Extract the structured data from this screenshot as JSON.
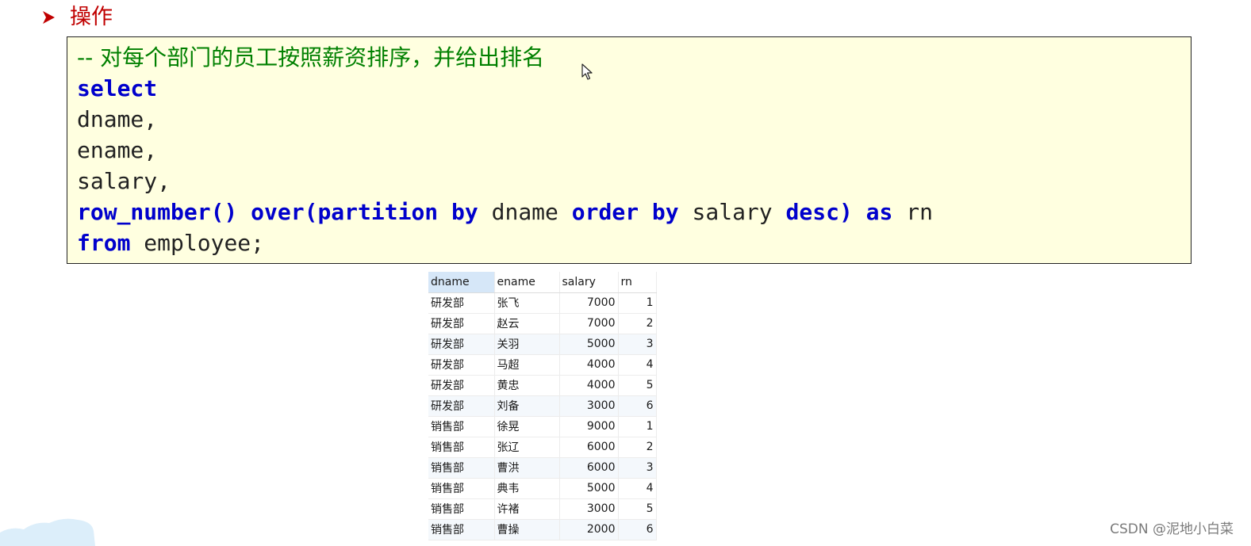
{
  "heading": {
    "title": "操作"
  },
  "code": {
    "comment": "-- 对每个部门的员工按照薪资排序，并给出排名",
    "line_select": "select",
    "line_dname": "dname,",
    "line_ename": "ename,",
    "line_salary": "salary,",
    "fn_row_number": "row_number()",
    "kw_over": "over(partition",
    "kw_by1": "by",
    "id_dname": "dname",
    "kw_order": "order",
    "kw_by2": "by",
    "id_salary": "salary",
    "kw_desc": "desc)",
    "kw_as": "as",
    "id_rn": "rn",
    "kw_from": "from",
    "id_employee": "employee;"
  },
  "table": {
    "columns": [
      "dname",
      "ename",
      "salary",
      "rn"
    ],
    "rows": [
      [
        "研发部",
        "张飞",
        "7000",
        "1"
      ],
      [
        "研发部",
        "赵云",
        "7000",
        "2"
      ],
      [
        "研发部",
        "关羽",
        "5000",
        "3"
      ],
      [
        "研发部",
        "马超",
        "4000",
        "4"
      ],
      [
        "研发部",
        "黄忠",
        "4000",
        "5"
      ],
      [
        "研发部",
        "刘备",
        "3000",
        "6"
      ],
      [
        "销售部",
        "徐晃",
        "9000",
        "1"
      ],
      [
        "销售部",
        "张辽",
        "6000",
        "2"
      ],
      [
        "销售部",
        "曹洪",
        "6000",
        "3"
      ],
      [
        "销售部",
        "典韦",
        "5000",
        "4"
      ],
      [
        "销售部",
        "许褚",
        "3000",
        "5"
      ],
      [
        "销售部",
        "曹操",
        "2000",
        "6"
      ]
    ]
  },
  "watermark": "CSDN @泥地小白菜",
  "icons": {
    "bullet": "arrowhead-bullet-icon",
    "cursor": "mouse-cursor-icon"
  },
  "colors": {
    "heading": "#c00000",
    "keyword": "#0000cc",
    "comment": "#008000",
    "code_background": "#ffffe0",
    "active_header": "#d6e7f8"
  }
}
